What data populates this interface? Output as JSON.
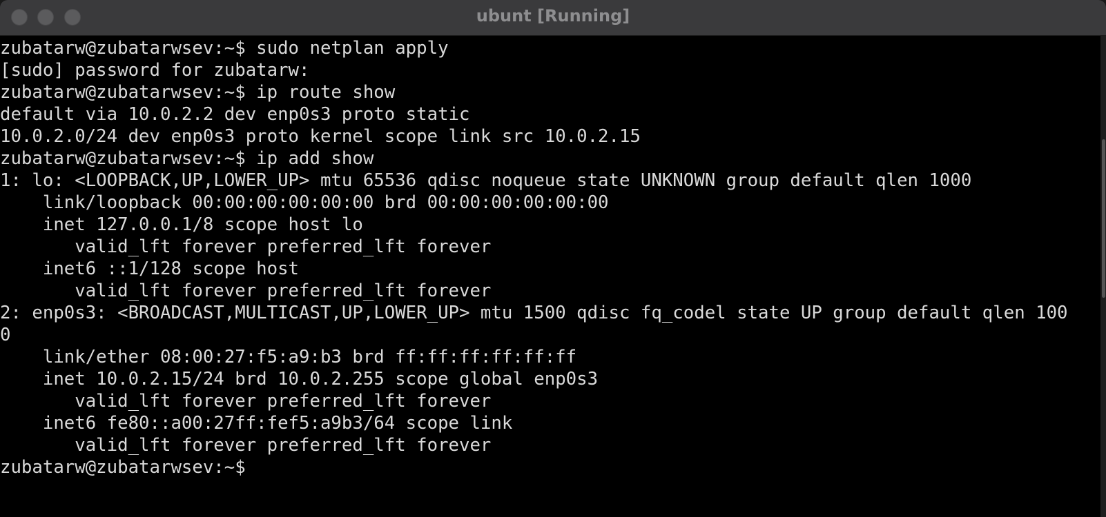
{
  "window": {
    "title": "ubunt [Running]"
  },
  "terminal": {
    "lines": [
      "zubatarw@zubatarwsev:~$ sudo netplan apply",
      "[sudo] password for zubatarw:",
      "zubatarw@zubatarwsev:~$ ip route show",
      "default via 10.0.2.2 dev enp0s3 proto static",
      "10.0.2.0/24 dev enp0s3 proto kernel scope link src 10.0.2.15",
      "zubatarw@zubatarwsev:~$ ip add show",
      "1: lo: <LOOPBACK,UP,LOWER_UP> mtu 65536 qdisc noqueue state UNKNOWN group default qlen 1000",
      "    link/loopback 00:00:00:00:00:00 brd 00:00:00:00:00:00",
      "    inet 127.0.0.1/8 scope host lo",
      "       valid_lft forever preferred_lft forever",
      "    inet6 ::1/128 scope host",
      "       valid_lft forever preferred_lft forever",
      "2: enp0s3: <BROADCAST,MULTICAST,UP,LOWER_UP> mtu 1500 qdisc fq_codel state UP group default qlen 100",
      "0",
      "    link/ether 08:00:27:f5:a9:b3 brd ff:ff:ff:ff:ff:ff",
      "    inet 10.0.2.15/24 brd 10.0.2.255 scope global enp0s3",
      "       valid_lft forever preferred_lft forever",
      "    inet6 fe80::a00:27ff:fef5:a9b3/64 scope link",
      "       valid_lft forever preferred_lft forever",
      "zubatarw@zubatarwsev:~$"
    ]
  },
  "colors": {
    "titlebar": "#3a3a3c",
    "background": "#000000",
    "text": "#d9d9d9"
  }
}
